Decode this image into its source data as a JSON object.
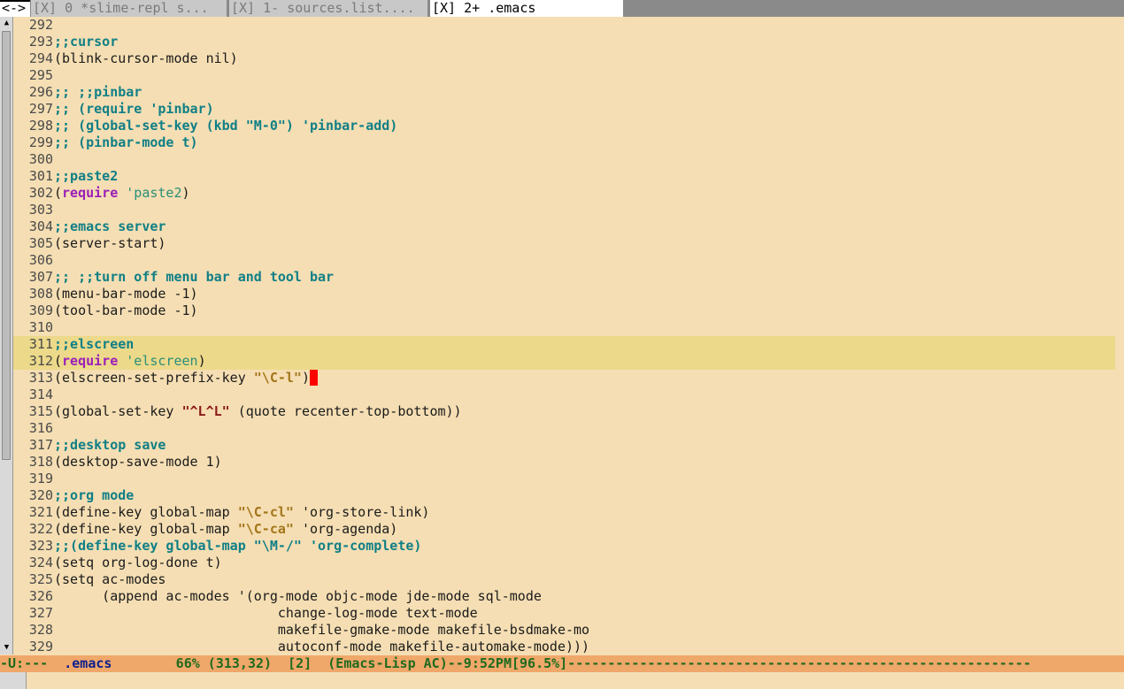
{
  "tabs": [
    {
      "label": "<->",
      "current": false
    },
    {
      "label": "[X] 0  *slime-repl s...",
      "current": false
    },
    {
      "label": "[X] 1- sources.list....",
      "current": false
    },
    {
      "label": "[X] 2+ .emacs",
      "current": true
    }
  ],
  "cursor_line": 313,
  "highlight_lines": [
    311,
    312
  ],
  "lines": [
    {
      "n": "292",
      "t": []
    },
    {
      "n": "293",
      "t": [
        [
          "c",
          ";;cursor"
        ]
      ]
    },
    {
      "n": "294",
      "t": [
        [
          "p",
          "(blink-cursor-mode nil)"
        ]
      ]
    },
    {
      "n": "295",
      "t": []
    },
    {
      "n": "296",
      "t": [
        [
          "c",
          ";; ;;pinbar"
        ]
      ]
    },
    {
      "n": "297",
      "t": [
        [
          "c",
          ";; (require 'pinbar)"
        ]
      ]
    },
    {
      "n": "298",
      "t": [
        [
          "c",
          ";; (global-set-key (kbd \"M-0\") 'pinbar-add)"
        ]
      ]
    },
    {
      "n": "299",
      "t": [
        [
          "c",
          ";; (pinbar-mode t)"
        ]
      ]
    },
    {
      "n": "300",
      "t": []
    },
    {
      "n": "301",
      "t": [
        [
          "c",
          ";;paste2"
        ]
      ]
    },
    {
      "n": "302",
      "t": [
        [
          "p",
          "("
        ],
        [
          "k",
          "require"
        ],
        [
          "p",
          " "
        ],
        [
          "q",
          "'paste2"
        ],
        [
          "p",
          ")"
        ]
      ]
    },
    {
      "n": "303",
      "t": []
    },
    {
      "n": "304",
      "t": [
        [
          "c",
          ";;emacs server"
        ]
      ]
    },
    {
      "n": "305",
      "t": [
        [
          "p",
          "(server-start)"
        ]
      ]
    },
    {
      "n": "306",
      "t": []
    },
    {
      "n": "307",
      "t": [
        [
          "c",
          ";; ;;turn off menu bar and tool bar"
        ]
      ]
    },
    {
      "n": "308",
      "t": [
        [
          "p",
          "(menu-bar-mode -1)"
        ]
      ]
    },
    {
      "n": "309",
      "t": [
        [
          "p",
          "(tool-bar-mode -1)"
        ]
      ]
    },
    {
      "n": "310",
      "t": []
    },
    {
      "n": "311",
      "t": [
        [
          "c",
          ";;elscreen"
        ]
      ]
    },
    {
      "n": "312",
      "t": [
        [
          "p",
          "("
        ],
        [
          "k",
          "require"
        ],
        [
          "p",
          " "
        ],
        [
          "q",
          "'elscreen"
        ],
        [
          "p",
          ")"
        ]
      ]
    },
    {
      "n": "313",
      "t": [
        [
          "p",
          "(elscreen-set-prefix-key "
        ],
        [
          "s",
          "\"\\C-l\""
        ],
        [
          "p",
          ")"
        ]
      ]
    },
    {
      "n": "314",
      "t": []
    },
    {
      "n": "315",
      "t": [
        [
          "p",
          "(global-set-key "
        ],
        [
          "s2",
          "\"^L^L\""
        ],
        [
          "p",
          " (quote recenter-top-bottom))"
        ]
      ]
    },
    {
      "n": "316",
      "t": []
    },
    {
      "n": "317",
      "t": [
        [
          "c",
          ";;desktop save"
        ]
      ]
    },
    {
      "n": "318",
      "t": [
        [
          "p",
          "(desktop-save-mode 1)"
        ]
      ]
    },
    {
      "n": "319",
      "t": []
    },
    {
      "n": "320",
      "t": [
        [
          "c",
          ";;org mode"
        ]
      ]
    },
    {
      "n": "321",
      "t": [
        [
          "p",
          "(define-key global-map "
        ],
        [
          "s",
          "\"\\C-cl\""
        ],
        [
          "p",
          " 'org-store-link)"
        ]
      ]
    },
    {
      "n": "322",
      "t": [
        [
          "p",
          "(define-key global-map "
        ],
        [
          "s",
          "\"\\C-ca\""
        ],
        [
          "p",
          " 'org-agenda)"
        ]
      ]
    },
    {
      "n": "323",
      "t": [
        [
          "c",
          ";;(define-key global-map \"\\M-/\" 'org-complete)"
        ]
      ]
    },
    {
      "n": "324",
      "t": [
        [
          "p",
          "(setq org-log-done t)"
        ]
      ]
    },
    {
      "n": "325",
      "t": [
        [
          "p",
          "(setq ac-modes"
        ]
      ]
    },
    {
      "n": "326",
      "t": [
        [
          "p",
          "      (append ac-modes '(org-mode objc-mode jde-mode sql-mode"
        ]
      ]
    },
    {
      "n": "327",
      "t": [
        [
          "p",
          "                            change-log-mode text-mode"
        ]
      ]
    },
    {
      "n": "328",
      "t": [
        [
          "p",
          "                            makefile-gmake-mode makefile-bsdmake-mo"
        ]
      ]
    },
    {
      "n": "329",
      "t": [
        [
          "p",
          "                            autoconf-mode makefile-automake-mode)))"
        ]
      ]
    }
  ],
  "modeline": {
    "prefix": "-U:---  ",
    "filename": ".emacs",
    "rest": "        66% (313,32)  [2]  (Emacs-Lisp AC)--9:52PM[96.5%]----------------------------------------------------------"
  },
  "icons": {
    "scroll_up": "▲",
    "scroll_down": "▼"
  }
}
